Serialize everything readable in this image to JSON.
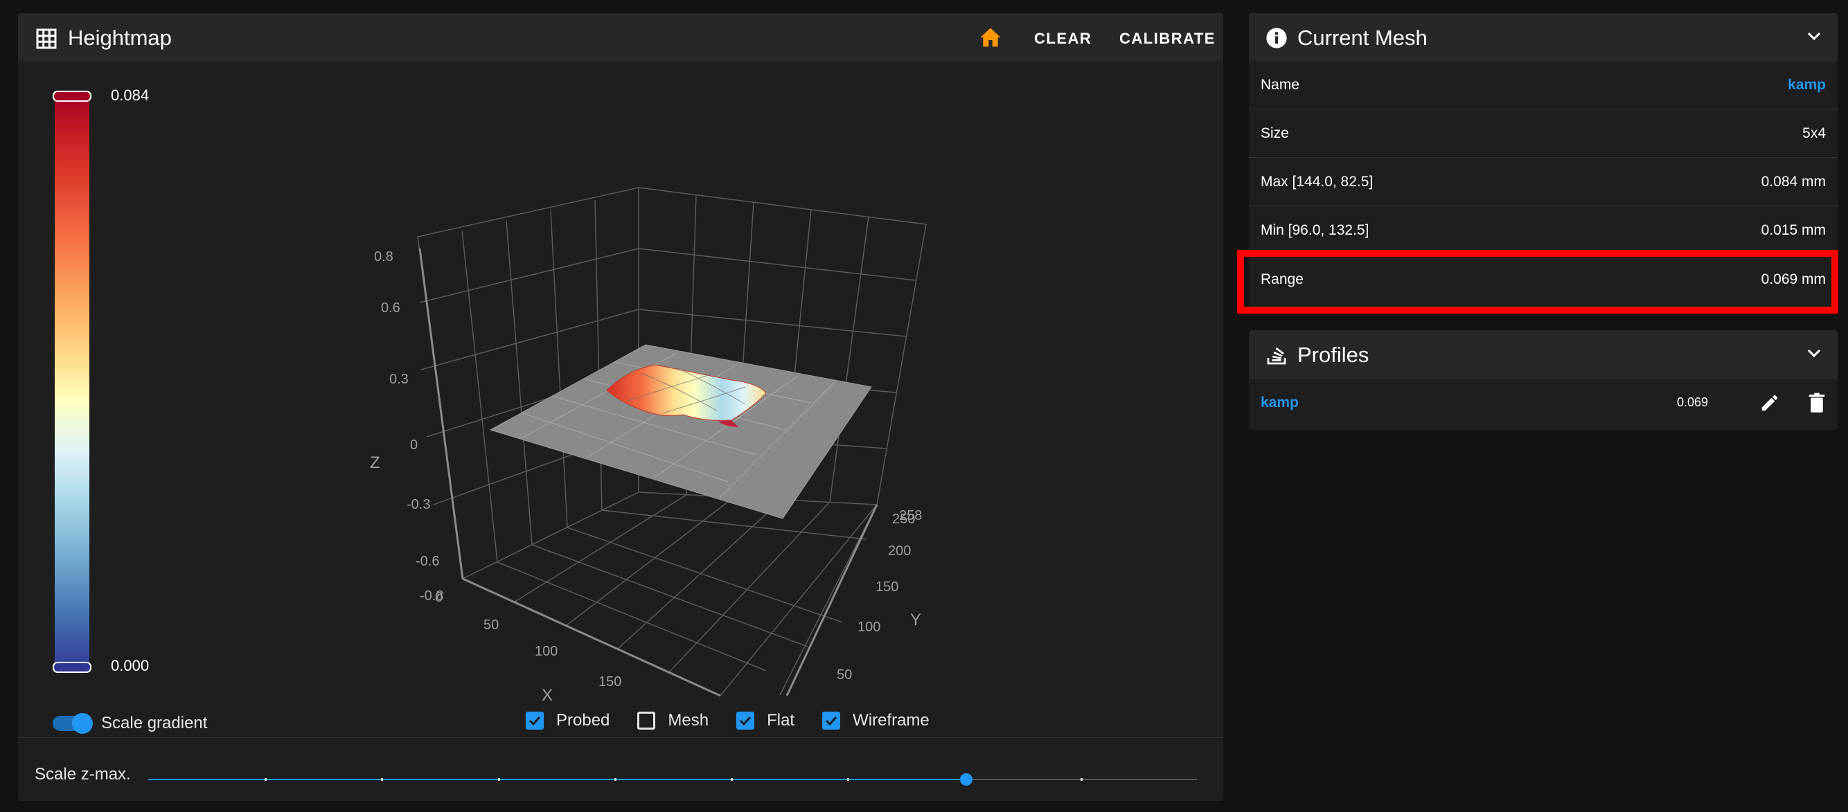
{
  "heightmap": {
    "title": "Heightmap",
    "clear_label": "CLEAR",
    "calibrate_label": "CALIBRATE",
    "colorbar": {
      "max_label": "0.084",
      "min_label": "0.000"
    },
    "axes": {
      "z_label": "Z",
      "x_label": "X",
      "y_label": "Y",
      "z_ticks": [
        "0.8",
        "0.6",
        "0.3",
        "0",
        "-0.3",
        "-0.6",
        "-0.8"
      ],
      "x_ticks": [
        "0",
        "50",
        "100",
        "150"
      ],
      "y_ticks": [
        "258",
        "250",
        "200",
        "150",
        "100",
        "50"
      ]
    },
    "scale_gradient_label": "Scale gradient",
    "scale_gradient_on": true,
    "options": [
      {
        "label": "Probed",
        "checked": true
      },
      {
        "label": "Mesh",
        "checked": false
      },
      {
        "label": "Flat",
        "checked": true
      },
      {
        "label": "Wireframe",
        "checked": true
      }
    ],
    "scale_zmax_label": "Scale z-max.",
    "scale_zmax_value": 0.78
  },
  "current_mesh": {
    "title": "Current Mesh",
    "rows": [
      {
        "label": "Name",
        "value": "kamp"
      },
      {
        "label": "Size",
        "value": "5x4"
      },
      {
        "label": "Max [144.0, 82.5]",
        "value": "0.084 mm"
      },
      {
        "label": "Min [96.0, 132.5]",
        "value": "0.015 mm"
      },
      {
        "label": "Range",
        "value": "0.069 mm"
      }
    ]
  },
  "profiles": {
    "title": "Profiles",
    "items": [
      {
        "name": "kamp",
        "value": "0.069"
      }
    ]
  },
  "colors": {
    "accent": "#2196f3",
    "home_icon": "#ff9800",
    "highlight": "#ff0000"
  }
}
